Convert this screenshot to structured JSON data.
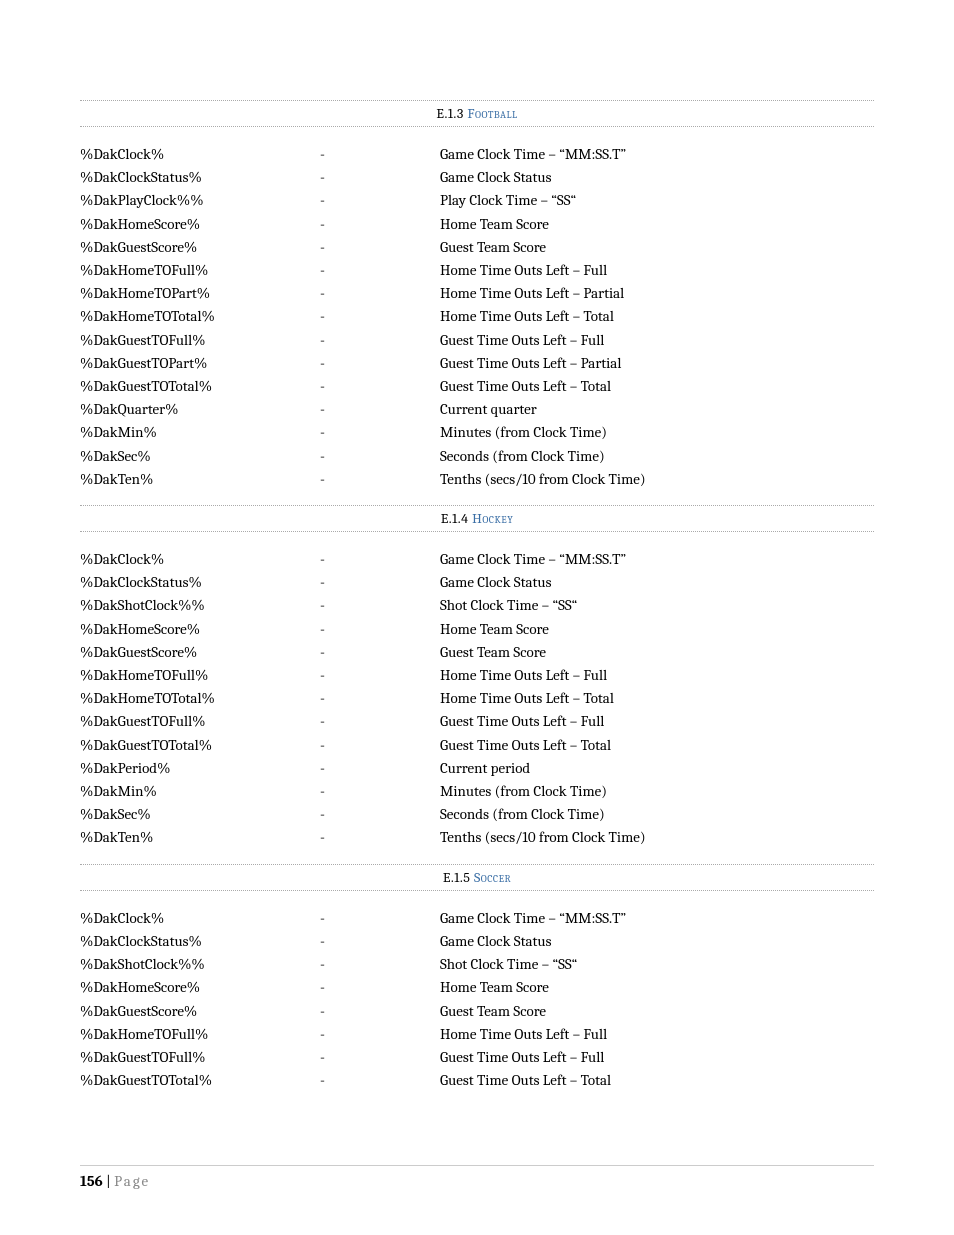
{
  "sections": [
    {
      "number": "E.1.3",
      "title": "Football",
      "rows": [
        {
          "var": "%DakClock%",
          "desc": "Game Clock Time – “MM:SS.T”"
        },
        {
          "var": "%DakClockStatus%",
          "desc": "Game Clock Status"
        },
        {
          "var": "%DakPlayClock%%",
          "desc": "Play Clock Time – “SS“"
        },
        {
          "var": "%DakHomeScore%",
          "desc": "Home Team Score"
        },
        {
          "var": "%DakGuestScore%",
          "desc": "Guest Team Score"
        },
        {
          "var": "%DakHomeTOFull%",
          "desc": "Home Time Outs Left – Full"
        },
        {
          "var": "%DakHomeTOPart%",
          "desc": "Home Time Outs Left – Partial"
        },
        {
          "var": "%DakHomeTOTotal%",
          "desc": "Home Time Outs Left – Total"
        },
        {
          "var": "%DakGuestTOFull%",
          "desc": "Guest Time Outs Left – Full"
        },
        {
          "var": "%DakGuestTOPart%",
          "desc": "Guest Time Outs Left – Partial"
        },
        {
          "var": "%DakGuestTOTotal%",
          "desc": "Guest Time Outs Left – Total"
        },
        {
          "var": "%DakQuarter%",
          "desc": "Current quarter"
        },
        {
          "var": "%DakMin%",
          "desc": "Minutes (from Clock Time)"
        },
        {
          "var": "%DakSec%",
          "desc": "Seconds (from Clock Time)"
        },
        {
          "var": "%DakTen%",
          "desc": "Tenths (secs/10 from Clock Time)"
        }
      ]
    },
    {
      "number": "E.1.4",
      "title": "Hockey",
      "rows": [
        {
          "var": "%DakClock%",
          "desc": "Game Clock Time – “MM:SS.T”"
        },
        {
          "var": "%DakClockStatus%",
          "desc": "Game Clock Status"
        },
        {
          "var": "%DakShotClock%%",
          "desc": "Shot Clock Time – “SS“"
        },
        {
          "var": "%DakHomeScore%",
          "desc": "Home Team Score"
        },
        {
          "var": "%DakGuestScore%",
          "desc": "Guest Team Score"
        },
        {
          "var": "%DakHomeTOFull%",
          "desc": "Home Time Outs Left – Full"
        },
        {
          "var": "%DakHomeTOTotal%",
          "desc": "Home Time Outs Left – Total"
        },
        {
          "var": "%DakGuestTOFull%",
          "desc": "Guest Time Outs Left – Full"
        },
        {
          "var": "%DakGuestTOTotal%",
          "desc": "Guest Time Outs Left – Total"
        },
        {
          "var": "%DakPeriod%",
          "desc": "Current period"
        },
        {
          "var": "%DakMin%",
          "desc": "Minutes (from Clock Time)"
        },
        {
          "var": "%DakSec%",
          "desc": "Seconds (from Clock Time)"
        },
        {
          "var": "%DakTen%",
          "desc": "Tenths (secs/10 from Clock Time)"
        }
      ]
    },
    {
      "number": "E.1.5",
      "title": "Soccer",
      "rows": [
        {
          "var": "%DakClock%",
          "desc": "Game Clock Time – “MM:SS.T”"
        },
        {
          "var": "%DakClockStatus%",
          "desc": "Game Clock Status"
        },
        {
          "var": "%DakShotClock%%",
          "desc": "Shot Clock Time – “SS“"
        },
        {
          "var": "%DakHomeScore%",
          "desc": "Home Team Score"
        },
        {
          "var": "%DakGuestScore%",
          "desc": "Guest Team Score"
        },
        {
          "var": "%DakHomeTOFull%",
          "desc": "Home Time Outs Left – Full"
        },
        {
          "var": "%DakGuestTOFull%",
          "desc": "Guest Time Outs Left – Full"
        },
        {
          "var": "%DakGuestTOTotal%",
          "desc": "Guest Time Outs Left – Total"
        }
      ]
    }
  ],
  "dash": "-",
  "footer": {
    "pageNumber": "156",
    "sep": " | ",
    "label": "Page"
  }
}
